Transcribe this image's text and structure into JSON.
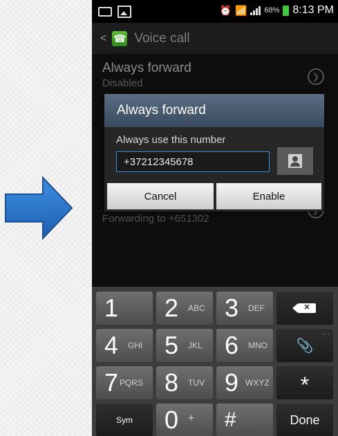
{
  "status_bar": {
    "battery_percent": "68%",
    "time": "8:13 PM"
  },
  "action_bar": {
    "back": "<",
    "title": "Voice call"
  },
  "settings_list": {
    "item1_title": "Always forward",
    "item1_subtitle": "Disabled",
    "item2_subtitle": "Forwarding to +651302"
  },
  "dialog": {
    "title": "Always forward",
    "label": "Always use this number",
    "number_value": "+37212345678",
    "cancel_label": "Cancel",
    "enable_label": "Enable"
  },
  "keyboard": {
    "keys": [
      {
        "num": "1",
        "letters": ""
      },
      {
        "num": "2",
        "letters": "ABC"
      },
      {
        "num": "3",
        "letters": "DEF"
      },
      {
        "num": "4",
        "letters": "GHI"
      },
      {
        "num": "5",
        "letters": "JKL"
      },
      {
        "num": "6",
        "letters": "MNO"
      },
      {
        "num": "7",
        "letters": "PQRS"
      },
      {
        "num": "8",
        "letters": "TUV"
      },
      {
        "num": "9",
        "letters": "WXYZ"
      },
      {
        "num": "0",
        "letters": "+"
      }
    ],
    "sym_label": "Sym",
    "star_label": "*",
    "hash_label": "#",
    "done_label": "Done"
  },
  "colors": {
    "arrow": "#2a7ad5",
    "dialog_title_bg": "#4a5c72",
    "input_border": "#3a8fd8",
    "battery": "#3fc83f"
  }
}
